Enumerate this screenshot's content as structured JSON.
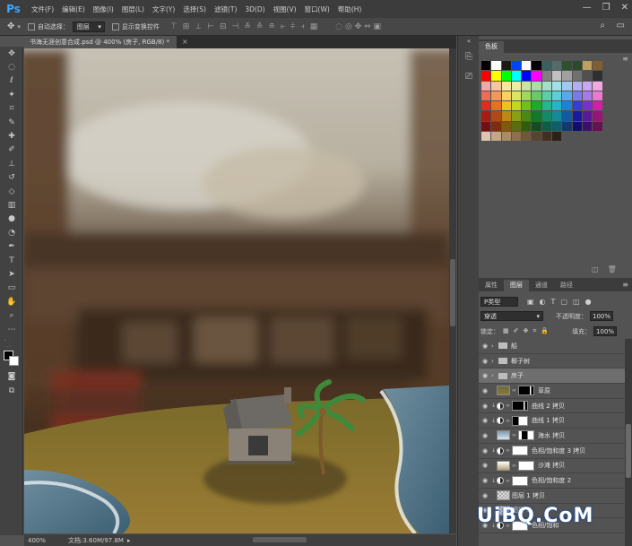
{
  "app": {
    "logo": "Ps"
  },
  "menu": [
    "文件(F)",
    "编辑(E)",
    "图像(I)",
    "图层(L)",
    "文字(Y)",
    "选择(S)",
    "滤镜(T)",
    "3D(D)",
    "视图(V)",
    "窗口(W)",
    "帮助(H)"
  ],
  "window_controls": {
    "minimize": "—",
    "restore": "❐",
    "close": "✕"
  },
  "options": {
    "auto_select_label": "自动选择：",
    "auto_select_value": "图层",
    "transform_label": "显示变换控件"
  },
  "document": {
    "tab_title": "书海无涯创意合成.psd @ 400% (房子, RGB/8) *",
    "close": "×"
  },
  "status": {
    "zoom": "400%",
    "doc_size": "文档:3.60M/97.8M"
  },
  "swatches": {
    "tab_label": "色板",
    "rows": [
      [
        "#000000",
        "#ffffff",
        "#1a1a1a",
        "#0044ff",
        "#ffffff",
        "#000000",
        "#3a5f5f",
        "#556b6b",
        "#2f4f2f",
        "#2b4a2b",
        "#c0a060",
        "#806030"
      ],
      [
        "#ff0000",
        "#ffff00",
        "#00ff00",
        "#00ffff",
        "#0000ff",
        "#ff00ff",
        "#808080",
        "#c0c0c0",
        "#a0a0a0",
        "#707070",
        "#505050",
        "#303030"
      ],
      [
        "#f4a6a0",
        "#f7c6a0",
        "#fbe6a0",
        "#e6f0a0",
        "#c8e6a0",
        "#a8dca8",
        "#a0e0c8",
        "#a0e0e6",
        "#a0c8f0",
        "#b0b0f0",
        "#c8a8f0",
        "#f0a8e0"
      ],
      [
        "#ee6a5a",
        "#f09a5a",
        "#f8d25a",
        "#d8e85a",
        "#a0d85a",
        "#6ac86a",
        "#5ad0a8",
        "#5ad0d8",
        "#5aa8e8",
        "#7a7ae8",
        "#a87ae8",
        "#e87ad0"
      ],
      [
        "#e22a20",
        "#e8701e",
        "#f0c01e",
        "#c0d81e",
        "#70c01e",
        "#20a830",
        "#20b890",
        "#20b8c8",
        "#2080d8",
        "#3a3ad8",
        "#7a30d0",
        "#d020a8"
      ],
      [
        "#a81a14",
        "#b04a14",
        "#b88a14",
        "#8aa014",
        "#4a8a14",
        "#14782a",
        "#148a68",
        "#148a98",
        "#145aa0",
        "#1a1aa0",
        "#5a1a98",
        "#981478"
      ],
      [
        "#701210",
        "#783010",
        "#7a5c10",
        "#5c6c10",
        "#305c10",
        "#105020",
        "#105c48",
        "#105c68",
        "#103c6c",
        "#10106c",
        "#3c1068",
        "#681050"
      ],
      [
        "#d8c8b0",
        "#c0a888",
        "#a88c68",
        "#8c7050",
        "#70583c",
        "#584430",
        "#403020",
        "#2c2018"
      ]
    ],
    "bottom_new": "◫",
    "bottom_trash": "🗑"
  },
  "layers": {
    "tabs": [
      "属性",
      "图层",
      "通道",
      "路径"
    ],
    "active_tab": 1,
    "filter": "P类型",
    "blend_mode": "穿透",
    "opacity_label": "不透明度：",
    "opacity_value": "100%",
    "lock_label": "锁定：",
    "fill_label": "填充：",
    "fill_value": "100%",
    "rows": [
      {
        "type": "group",
        "name": "船",
        "selected": false
      },
      {
        "type": "group",
        "name": "椰子树",
        "selected": false
      },
      {
        "type": "group",
        "name": "房子",
        "selected": true
      },
      {
        "type": "layer",
        "name": "草原",
        "thumb": "grass",
        "mask": "dark"
      },
      {
        "type": "adj",
        "name": "曲线 2 拷贝",
        "mask": "dark"
      },
      {
        "type": "adj",
        "name": "曲线 1 拷贝",
        "mask": "light"
      },
      {
        "type": "layer",
        "name": "海水 拷贝",
        "thumb": "sea",
        "mask": "mixed"
      },
      {
        "type": "adj",
        "name": "色相/饱和度 3 拷贝",
        "mask": "white"
      },
      {
        "type": "layer",
        "name": "沙滩 拷贝",
        "thumb": "sand",
        "mask": "white"
      },
      {
        "type": "adj",
        "name": "色相/饱和度 2",
        "mask": "white"
      },
      {
        "type": "layer",
        "name": "图层 1 拷贝",
        "thumb": "checker"
      },
      {
        "type": "layer",
        "name": "图层 1",
        "thumb": "checker"
      },
      {
        "type": "adj",
        "name": "色相/饱和",
        "mask": "white"
      }
    ]
  },
  "watermark": "UiBQ.CoM"
}
